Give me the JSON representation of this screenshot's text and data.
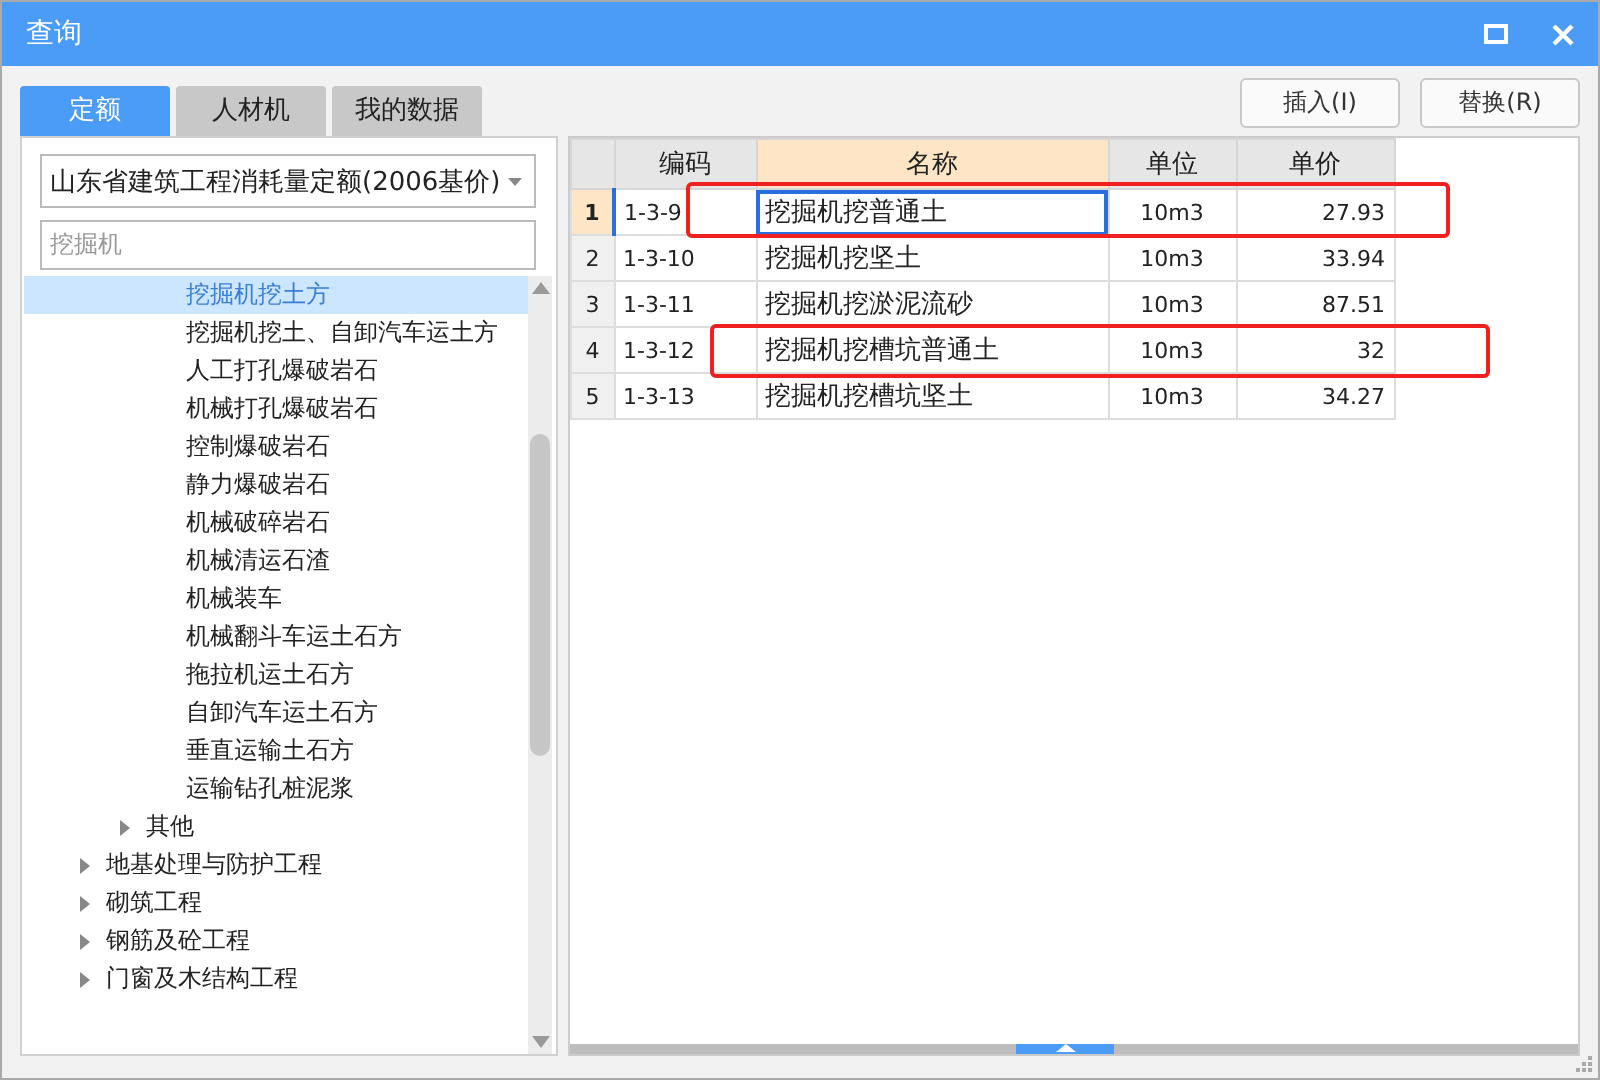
{
  "window": {
    "title": "查询"
  },
  "tabs": [
    {
      "label": "定额",
      "selected": true
    },
    {
      "label": "人材机",
      "selected": false
    },
    {
      "label": "我的数据",
      "selected": false
    }
  ],
  "buttons": [
    "插入(I)",
    "替换(R)"
  ],
  "library_select": {
    "value": "山东省建筑工程消耗量定额(2006基价)"
  },
  "search": {
    "value": "挖掘机"
  },
  "tree": [
    {
      "children": [
        {
          "children": [
            {
              "label": "挖掘机挖土方",
              "selected": true
            },
            {
              "label": "挖掘机挖土、自卸汽车运土方",
              "selected": false
            },
            {
              "label": "人工打孔爆破岩石",
              "selected": false
            },
            {
              "label": "机械打孔爆破岩石",
              "selected": false
            },
            {
              "label": "控制爆破岩石",
              "selected": false
            },
            {
              "label": "静力爆破岩石",
              "selected": false
            },
            {
              "label": "机械破碎岩石",
              "selected": false
            },
            {
              "label": "机械清运石渣",
              "selected": false
            },
            {
              "label": "机械装车",
              "selected": false
            },
            {
              "label": "机械翻斗车运土石方",
              "selected": false
            },
            {
              "label": "拖拉机运土石方",
              "selected": false
            },
            {
              "label": "自卸汽车运土石方",
              "selected": false
            },
            {
              "label": "垂直运输土石方",
              "selected": false
            },
            {
              "label": "运输钻孔桩泥浆",
              "selected": false
            }
          ]
        },
        {
          "label": "其他",
          "selected": false,
          "expanded": false
        }
      ]
    },
    {
      "label": "地基处理与防护工程",
      "selected": false,
      "expanded": false
    },
    {
      "label": "砌筑工程",
      "selected": false,
      "expanded": false
    },
    {
      "label": "钢筋及砼工程",
      "selected": false,
      "expanded": false
    },
    {
      "label": "门窗及木结构工程",
      "selected": false,
      "expanded": false
    }
  ],
  "table": {
    "columns": [
      "编码",
      "名称",
      "单位",
      "单价"
    ],
    "rows": [
      {
        "number": "1",
        "code": "1-3-9",
        "name": "挖掘机挖普通土",
        "unit": "10m3",
        "price": "27.93",
        "selected": true,
        "annotated": true
      },
      {
        "number": "2",
        "code": "1-3-10",
        "name": "挖掘机挖坚土",
        "unit": "10m3",
        "price": "33.94",
        "selected": false,
        "annotated": false
      },
      {
        "number": "3",
        "code": "1-3-11",
        "name": "挖掘机挖淤泥流砂",
        "unit": "10m3",
        "price": "87.51",
        "selected": false,
        "annotated": false
      },
      {
        "number": "4",
        "code": "1-3-12",
        "name": "挖掘机挖槽坑普通土",
        "unit": "10m3",
        "price": "32",
        "selected": false,
        "annotated": true
      },
      {
        "number": "5",
        "code": "1-3-13",
        "name": "挖掘机挖槽坑坚土",
        "unit": "10m3",
        "price": "34.27",
        "selected": false,
        "annotated": false
      }
    ]
  }
}
